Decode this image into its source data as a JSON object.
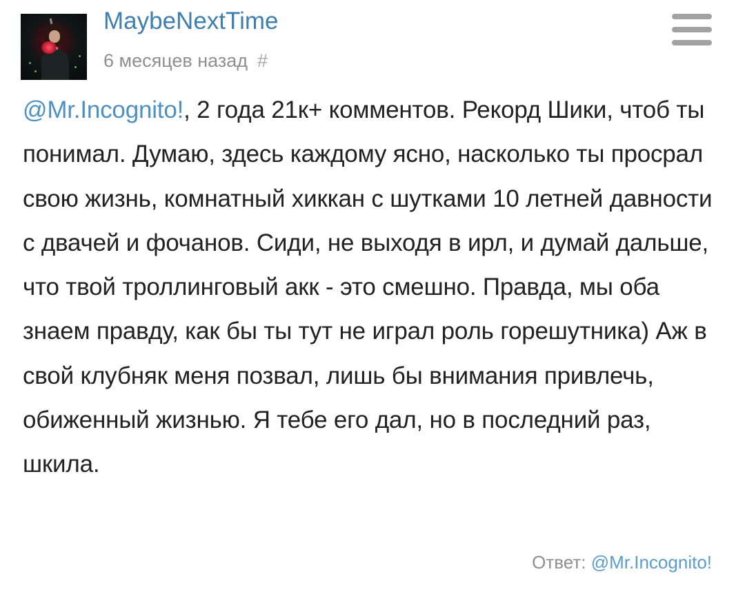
{
  "post": {
    "author": {
      "username": "MaybeNextTime",
      "avatar_icon": "avatar-image"
    },
    "time_ago": "6 месяцев назад",
    "permalink_symbol": "#",
    "menu_icon": "hamburger-menu-icon",
    "comment": {
      "mention": "@Mr.Incognito!",
      "text": ", 2 года 21к+ комментов. Рекорд Шики, чтоб ты понимал. Думаю, здесь каждому ясно, насколько ты просрал свою жизнь, комнатный хиккан с шутками 10 летней давности с двачей и фочанов. Сиди, не выходя в ирл, и думай дальше, что твой троллинговый акк - это смешно. Правда, мы оба знаем правду, как бы ты тут не играл роль горешутника) Аж в свой клубняк меня позвал, лишь бы внимания привлечь, обиженный жизнью. Я тебе его дал, но в последний раз, шкила."
    },
    "reply": {
      "label": "Ответ:",
      "mention": "@Mr.Incognito!"
    }
  },
  "colors": {
    "username": "#3e7fb0",
    "mention": "#4d90c4",
    "meta": "#8f8f8f",
    "body_text": "#222222",
    "menu_icon": "#a2a2a2"
  }
}
